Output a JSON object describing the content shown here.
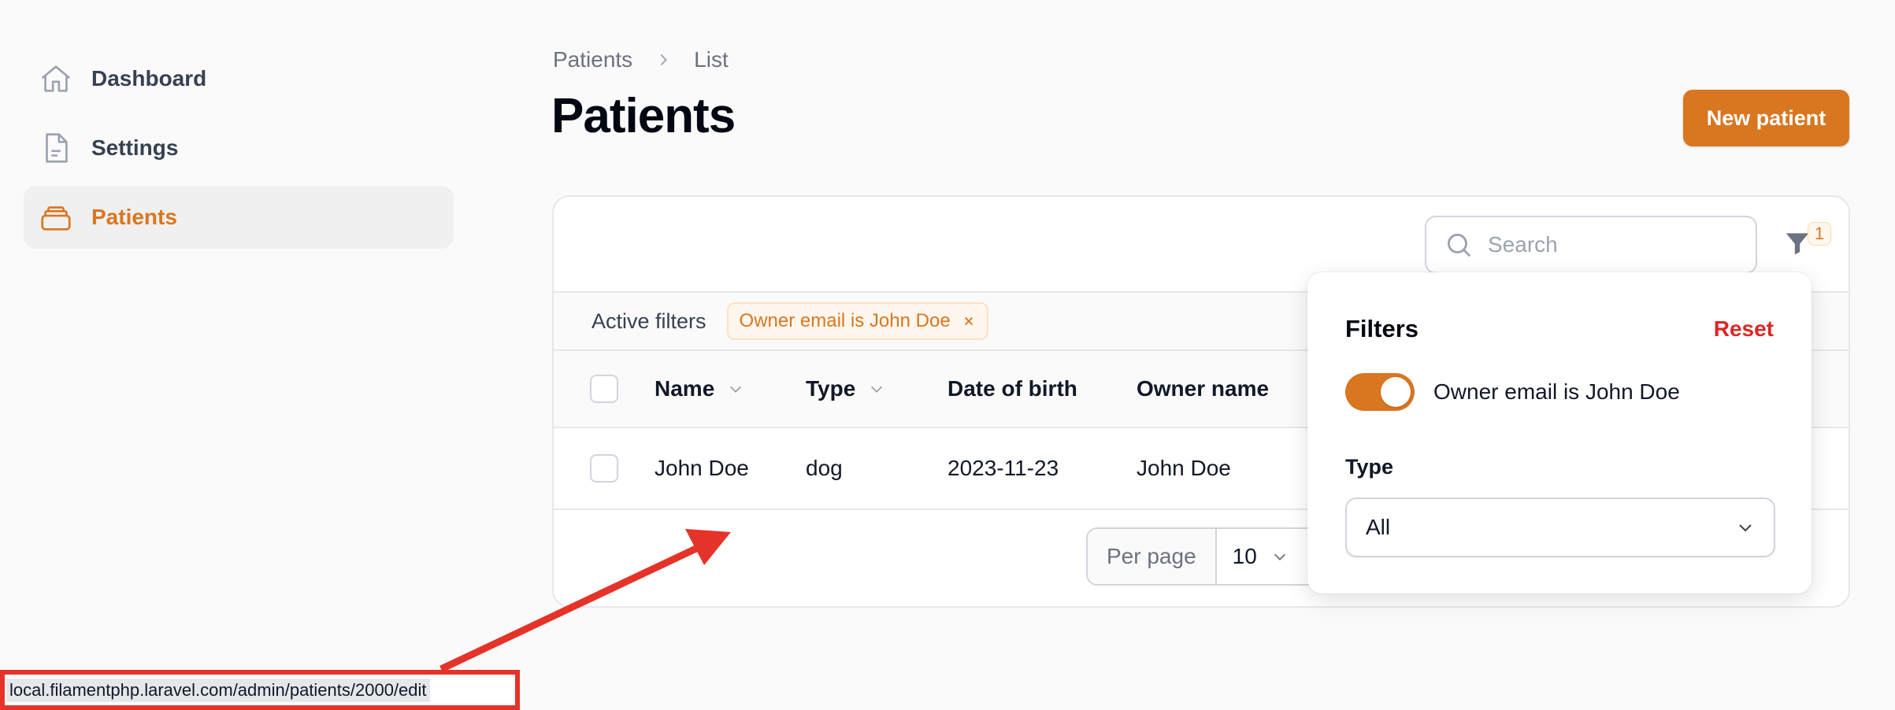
{
  "sidebar": {
    "items": [
      {
        "label": "Dashboard",
        "icon": "home-icon",
        "active": false
      },
      {
        "label": "Settings",
        "icon": "document-icon",
        "active": false
      },
      {
        "label": "Patients",
        "icon": "stack-icon",
        "active": true
      }
    ]
  },
  "breadcrumb": [
    "Patients",
    "List"
  ],
  "page": {
    "title": "Patients",
    "new_button": "New patient"
  },
  "search": {
    "placeholder": "Search"
  },
  "filter_button": {
    "badge": "1",
    "icon": "funnel-icon"
  },
  "active_filters": {
    "label": "Active filters",
    "chips": [
      "Owner email is John Doe"
    ]
  },
  "table": {
    "columns": [
      "Name",
      "Type",
      "Date of birth",
      "Owner name"
    ],
    "sortable": [
      true,
      true,
      false,
      false
    ],
    "rows": [
      [
        "John Doe",
        "dog",
        "2023-11-23",
        "John Doe"
      ]
    ]
  },
  "pagination": {
    "per_page_label": "Per page",
    "per_page_value": "10"
  },
  "filters_panel": {
    "title": "Filters",
    "reset": "Reset",
    "toggle_label": "Owner email is John Doe",
    "toggle_on": true,
    "type_label": "Type",
    "type_value": "All"
  },
  "statusbar": {
    "url": "local.filamentphp.laravel.com/admin/patients/2000/edit"
  },
  "colors": {
    "accent": "#d97620",
    "danger": "#dc2626",
    "annotation": "#e5332a"
  }
}
